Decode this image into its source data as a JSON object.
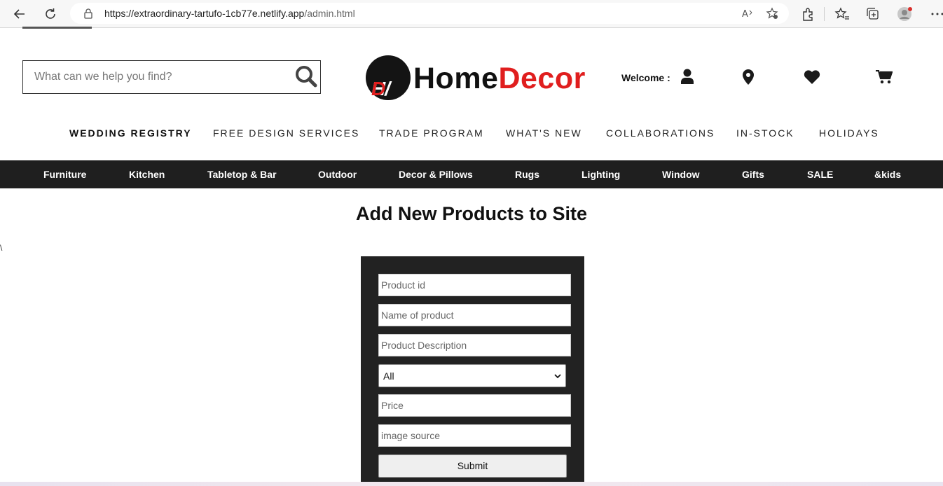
{
  "browser": {
    "url_host": "https://extraordinary-tartufo-1cb77e.netlify.app",
    "url_path": "/admin.html",
    "icons": [
      "back-icon",
      "refresh-icon",
      "lock-icon",
      "read-aloud-icon",
      "favorite-add-icon",
      "extensions-icon",
      "favorites-icon",
      "collections-icon",
      "profile-icon",
      "more-icon"
    ]
  },
  "header": {
    "search_placeholder": "What can we help you find?",
    "logo_badge_h": "H/",
    "logo_badge_d": "D",
    "logo_home": "Home",
    "logo_decor": "Decor",
    "welcome": "Welcome :"
  },
  "topnav": [
    {
      "label": "WEDDING REGISTRY"
    },
    {
      "label": "FREE DESIGN SERVICES"
    },
    {
      "label": "TRADE PROGRAM"
    },
    {
      "label": "WHAT'S NEW"
    },
    {
      "label": "COLLABORATIONS"
    },
    {
      "label": "IN-STOCK"
    },
    {
      "label": "HOLIDAYS"
    }
  ],
  "categories": [
    {
      "label": "Furniture"
    },
    {
      "label": "Kitchen"
    },
    {
      "label": "Tabletop & Bar"
    },
    {
      "label": "Outdoor"
    },
    {
      "label": "Decor & Pillows"
    },
    {
      "label": "Rugs"
    },
    {
      "label": "Lighting"
    },
    {
      "label": "Window"
    },
    {
      "label": "Gifts"
    },
    {
      "label": "SALE"
    },
    {
      "label": "&kids"
    }
  ],
  "main": {
    "title": "Add New Products to Site",
    "stray_char": "\\",
    "form": {
      "product_id_placeholder": "Product id",
      "name_placeholder": "Name of product",
      "description_placeholder": "Product Description",
      "category_selected": "All",
      "price_placeholder": "Price",
      "image_placeholder": "image source",
      "submit_label": "Submit"
    }
  },
  "colors": {
    "brand_red": "#e01e1e",
    "dark_bar": "#1f1f1f",
    "form_panel": "#222222"
  }
}
